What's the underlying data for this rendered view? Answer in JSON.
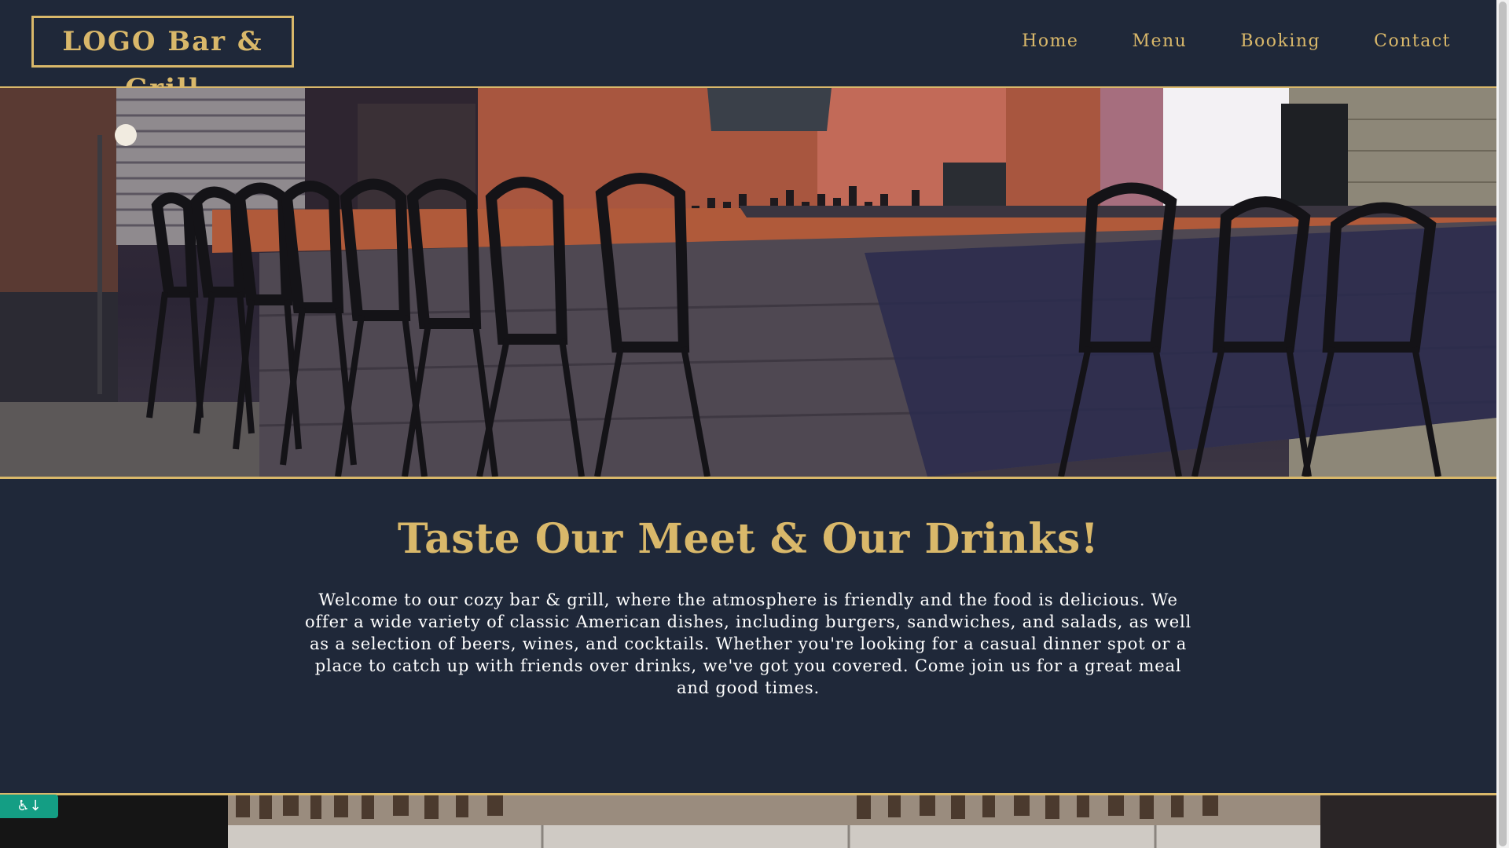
{
  "header": {
    "logo_text": "LOGO Bar & Grill",
    "nav": [
      "Home",
      "Menu",
      "Booking",
      "Contact"
    ]
  },
  "intro": {
    "heading": "Taste Our Meet & Our Drinks!",
    "body": "Welcome to our cozy bar & grill, where the atmosphere is friendly and the food is delicious. We offer a wide variety of classic American dishes, including burgers, sandwiches, and salads, as well as a selection of beers, wines, and cocktails. Whether you're looking for a casual dinner spot or a place to catch up with friends over drinks, we've got you covered. Come join us for a great meal and good times."
  },
  "colors": {
    "background": "#1f2839",
    "accent_gold": "#d9b86a",
    "text": "#ffffff",
    "accessibility_badge": "#149e84"
  },
  "icons": {
    "accessibility": "wheelchair-icon"
  }
}
